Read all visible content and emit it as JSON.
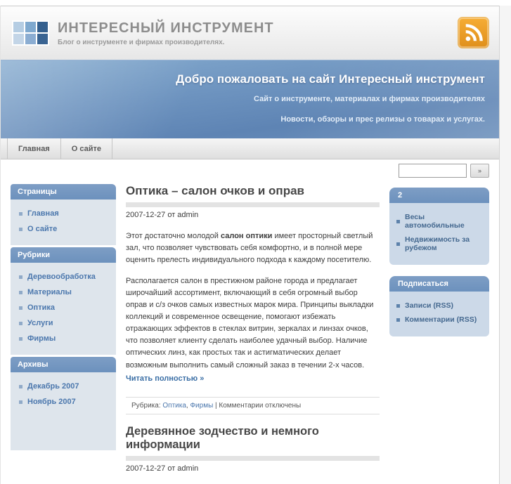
{
  "colors": {
    "banner_blue": "#6d93bf",
    "sidebar_header_blue": "#7095c2",
    "link_blue": "#4b77ad",
    "rss_orange": "#eea02a",
    "title_gray": "#8d8d8d"
  },
  "header": {
    "title": "ИНТЕРЕСНЫЙ ИНСТРУМЕНТ",
    "subtitle": "Блог о инструменте и фирмах производителях.",
    "logo_colors": [
      "#b5cde3",
      "#7fa9cf",
      "#35608e",
      "#c3d5e7",
      "#8badd2",
      "#3a6492"
    ]
  },
  "banner": {
    "heading": "Добро пожаловать на сайт Интересный инструмент",
    "line1": "Сайт о инструменте, материалах и фирмах производителях",
    "line2": "Новости, обзоры и прес релизы о товарах и услугах."
  },
  "nav": {
    "tabs": [
      "Главная",
      "О сайте"
    ]
  },
  "search": {
    "value": "",
    "button_label": "»"
  },
  "sidebar_left": {
    "sections": [
      {
        "title": "Страницы",
        "items": [
          "Главная",
          "О сайте"
        ]
      },
      {
        "title": "Рубрики",
        "items": [
          "Деревообработка",
          "Материалы",
          "Оптика",
          "Услуги",
          "Фирмы"
        ]
      },
      {
        "title": "Архивы",
        "items": [
          "Декабрь 2007",
          "Ноябрь 2007"
        ]
      }
    ]
  },
  "sidebar_right": {
    "boxes": [
      {
        "title": "2",
        "items": [
          "Весы автомобильные",
          "Недвижимость за рубежом"
        ]
      },
      {
        "title": "Подписаться",
        "items": [
          "Записи (RSS)",
          "Комментарии (RSS)"
        ]
      }
    ]
  },
  "main": {
    "posts": [
      {
        "title": "Оптика – салон очков и оправ",
        "date": "2007-12-27 от admin",
        "para1_pre": "Этот достаточно молодой ",
        "para1_bold": "салон оптики",
        "para1_post": " имеет просторный светлый зал, что позволяет чувствовать себя комфортно, и в полной мере оценить прелесть индивидуального подхода к каждому посетителю.",
        "para2": "Располагается салон в престижном районе города и предлагает широчайший ассортимент, включающий в себя огромный выбор оправ и с/з очков самых известных марок мира. Принципы выкладки коллекций и современное освещение, помогают избежать отражающих эффектов в стеклах витрин, зеркалах и линзах очков, что позволяет клиенту сделать наиболее удачный выбор. Наличие оптических линз, как простых так и астигматических делает возможным выполнить самый сложный заказ в течении 2-х часов.",
        "read_more": "Читать полностью »",
        "meta": {
          "label": "Рубрика: ",
          "cat1": "Оптика",
          "sep": ", ",
          "cat2": "Фирмы",
          "tail": " | Комментарии отключены"
        }
      },
      {
        "title": "Деревянное зодчество и немного информации",
        "date": "2007-12-27 от admin"
      }
    ]
  }
}
